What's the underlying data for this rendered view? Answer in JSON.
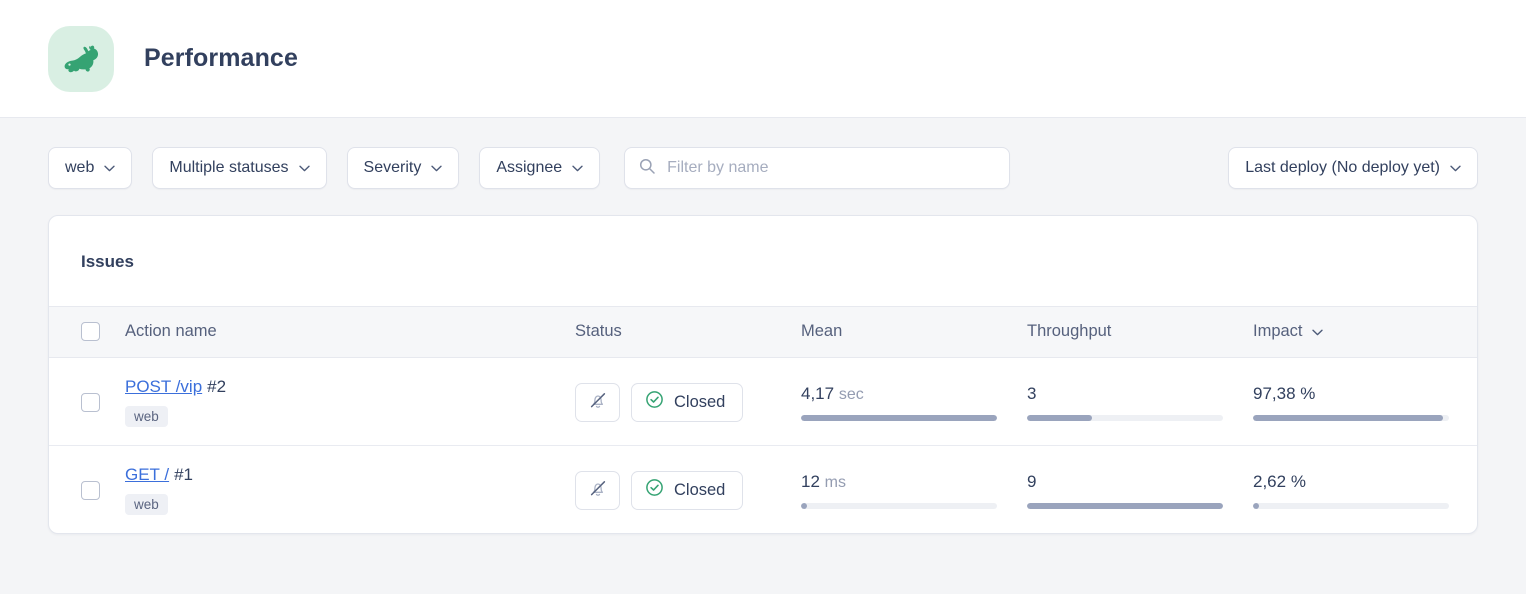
{
  "header": {
    "title": "Performance",
    "icon": "rabbit-icon",
    "icon_color": "#35a373",
    "icon_bg": "#d9efe3"
  },
  "filters": {
    "environment": {
      "label": "web"
    },
    "status": {
      "label": "Multiple statuses"
    },
    "severity": {
      "label": "Severity"
    },
    "assignee": {
      "label": "Assignee"
    },
    "search": {
      "value": "",
      "placeholder": "Filter by name"
    },
    "deploy": {
      "label": "Last deploy (No deploy yet)"
    }
  },
  "issues_card": {
    "title": "Issues",
    "columns": {
      "action": "Action name",
      "status": "Status",
      "mean": "Mean",
      "throughput": "Throughput",
      "impact": "Impact"
    },
    "sorted_by": "Impact",
    "rows": [
      {
        "action_link": "POST /vip",
        "action_number": "#2",
        "tag": "web",
        "mute_icon": "bell-muted-icon",
        "status_label": "Closed",
        "status_icon": "check-circle-icon",
        "mean_value": "4,17",
        "mean_unit": "sec",
        "mean_bar_pct": 100,
        "throughput_value": "3",
        "throughput_unit": "",
        "throughput_bar_pct": 33,
        "impact_value": "97,38",
        "impact_unit": "%",
        "impact_bar_pct": 97
      },
      {
        "action_link": "GET /",
        "action_number": "#1",
        "tag": "web",
        "mute_icon": "bell-muted-icon",
        "status_label": "Closed",
        "status_icon": "check-circle-icon",
        "mean_value": "12",
        "mean_unit": "ms",
        "mean_bar_pct": 3,
        "throughput_value": "9",
        "throughput_unit": "",
        "throughput_bar_pct": 100,
        "impact_value": "2,62",
        "impact_unit": "%",
        "impact_bar_pct": 3
      }
    ]
  },
  "colors": {
    "accent_link": "#3b6fdb",
    "success": "#35a373",
    "page_bg": "#f4f5f7"
  }
}
